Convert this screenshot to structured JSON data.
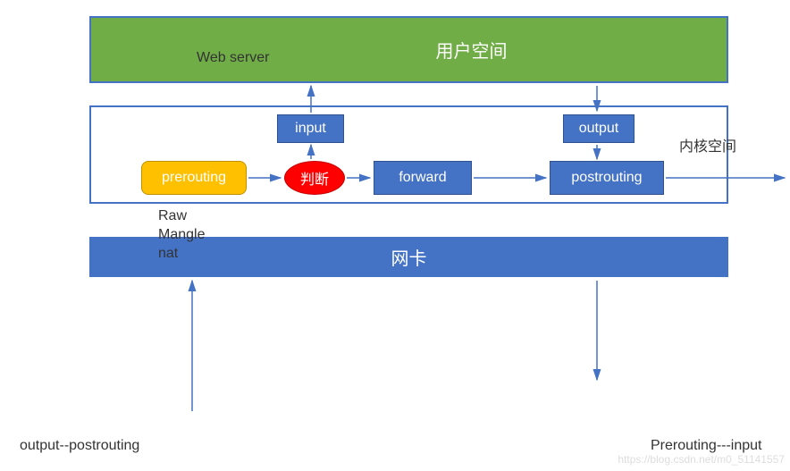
{
  "colors": {
    "blue": "#4472c4",
    "green": "#70ad47",
    "orange": "#ffc000",
    "red": "#ff0000"
  },
  "userspace": {
    "title": "用户空间"
  },
  "kernel": {
    "label": "内核空间",
    "nodes": {
      "prerouting": "prerouting",
      "judge": "判断",
      "input": "input",
      "forward": "forward",
      "output": "output",
      "postrouting": "postrouting"
    }
  },
  "nic": {
    "title": "网卡"
  },
  "labels": {
    "webserver": "Web server",
    "raw_mangle_nat": "Raw\nMangle\nnat",
    "output_to_postrouting": "output--postrouting",
    "prerouting_to_input": "Prerouting---input"
  },
  "watermark": "https://blog.csdn.net/m0_51141557"
}
